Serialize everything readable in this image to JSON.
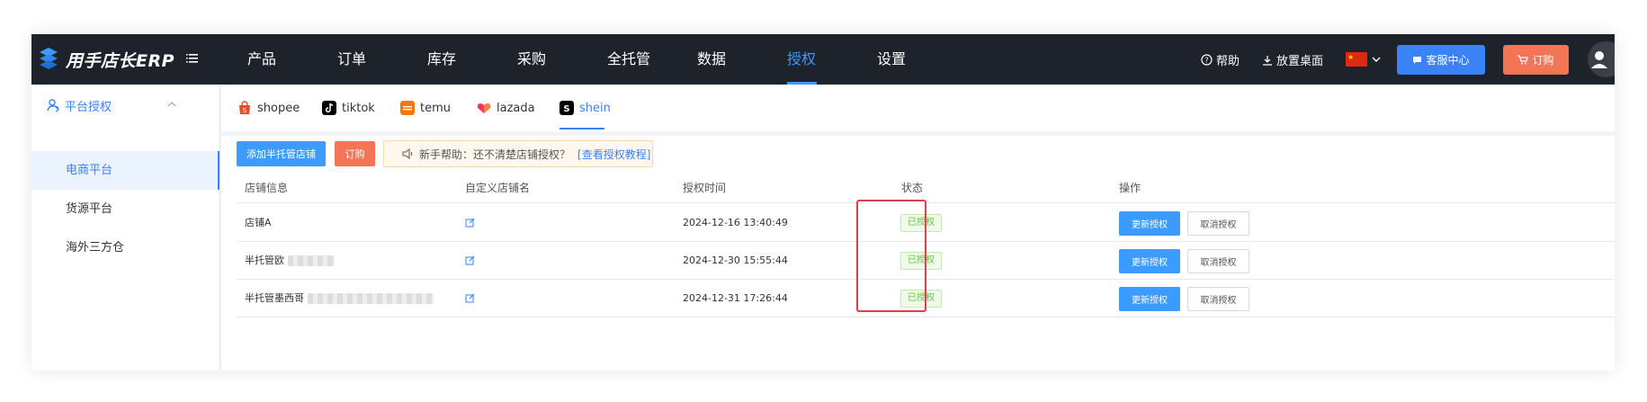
{
  "topbar": {
    "logo_text": "用手店长ERP",
    "nav": [
      {
        "label": "产品"
      },
      {
        "label": "订单"
      },
      {
        "label": "库存"
      },
      {
        "label": "采购"
      },
      {
        "label": "全托管"
      },
      {
        "label": "数据"
      },
      {
        "label": "授权"
      },
      {
        "label": "设置"
      }
    ],
    "active_nav": "授权",
    "help_label": "帮助",
    "desktop_label": "放置桌面",
    "service_label": "客服中心",
    "order_label": "订购"
  },
  "sidebar": {
    "group_label": "平台授权",
    "items": [
      {
        "label": "电商平台",
        "active": true
      },
      {
        "label": "货源平台",
        "active": false
      },
      {
        "label": "海外三方仓",
        "active": false
      }
    ]
  },
  "platform_tabs": [
    {
      "label": "shopee",
      "icon": "shopee-icon",
      "color": "#ee4d2d"
    },
    {
      "label": "tiktok",
      "icon": "tiktok-icon",
      "color": "#000000"
    },
    {
      "label": "temu",
      "icon": "temu-icon",
      "color": "#fb7701"
    },
    {
      "label": "lazada",
      "icon": "lazada-icon",
      "color": "#f5365c"
    },
    {
      "label": "shein",
      "icon": "shein-icon",
      "color": "#000000",
      "active": true
    }
  ],
  "toolbar": {
    "add_label": "添加半托管店铺",
    "order_label": "订购",
    "notice_text": "新手帮助：还不清楚店铺授权？",
    "notice_link": "[查看授权教程]"
  },
  "table": {
    "headers": [
      "店铺信息",
      "自定义店铺名",
      "授权时间",
      "状态",
      "操作"
    ],
    "rows": [
      {
        "store": "店铺A",
        "time": "2024-12-16 13:40:49",
        "status": "已授权"
      },
      {
        "store": "半托管欧",
        "time": "2024-12-30 15:55:44",
        "status": "已授权"
      },
      {
        "store": "半托管墨西哥",
        "time": "2024-12-31 17:26:44",
        "status": "已授权"
      }
    ],
    "update_label": "更新授权",
    "cancel_label": "取消授权"
  },
  "colors": {
    "accent": "#3b82f6",
    "topbar_bg": "#1e222b",
    "order_button": "#f47456",
    "status_green": "#67c23a",
    "highlight_red": "#e23d4f"
  }
}
